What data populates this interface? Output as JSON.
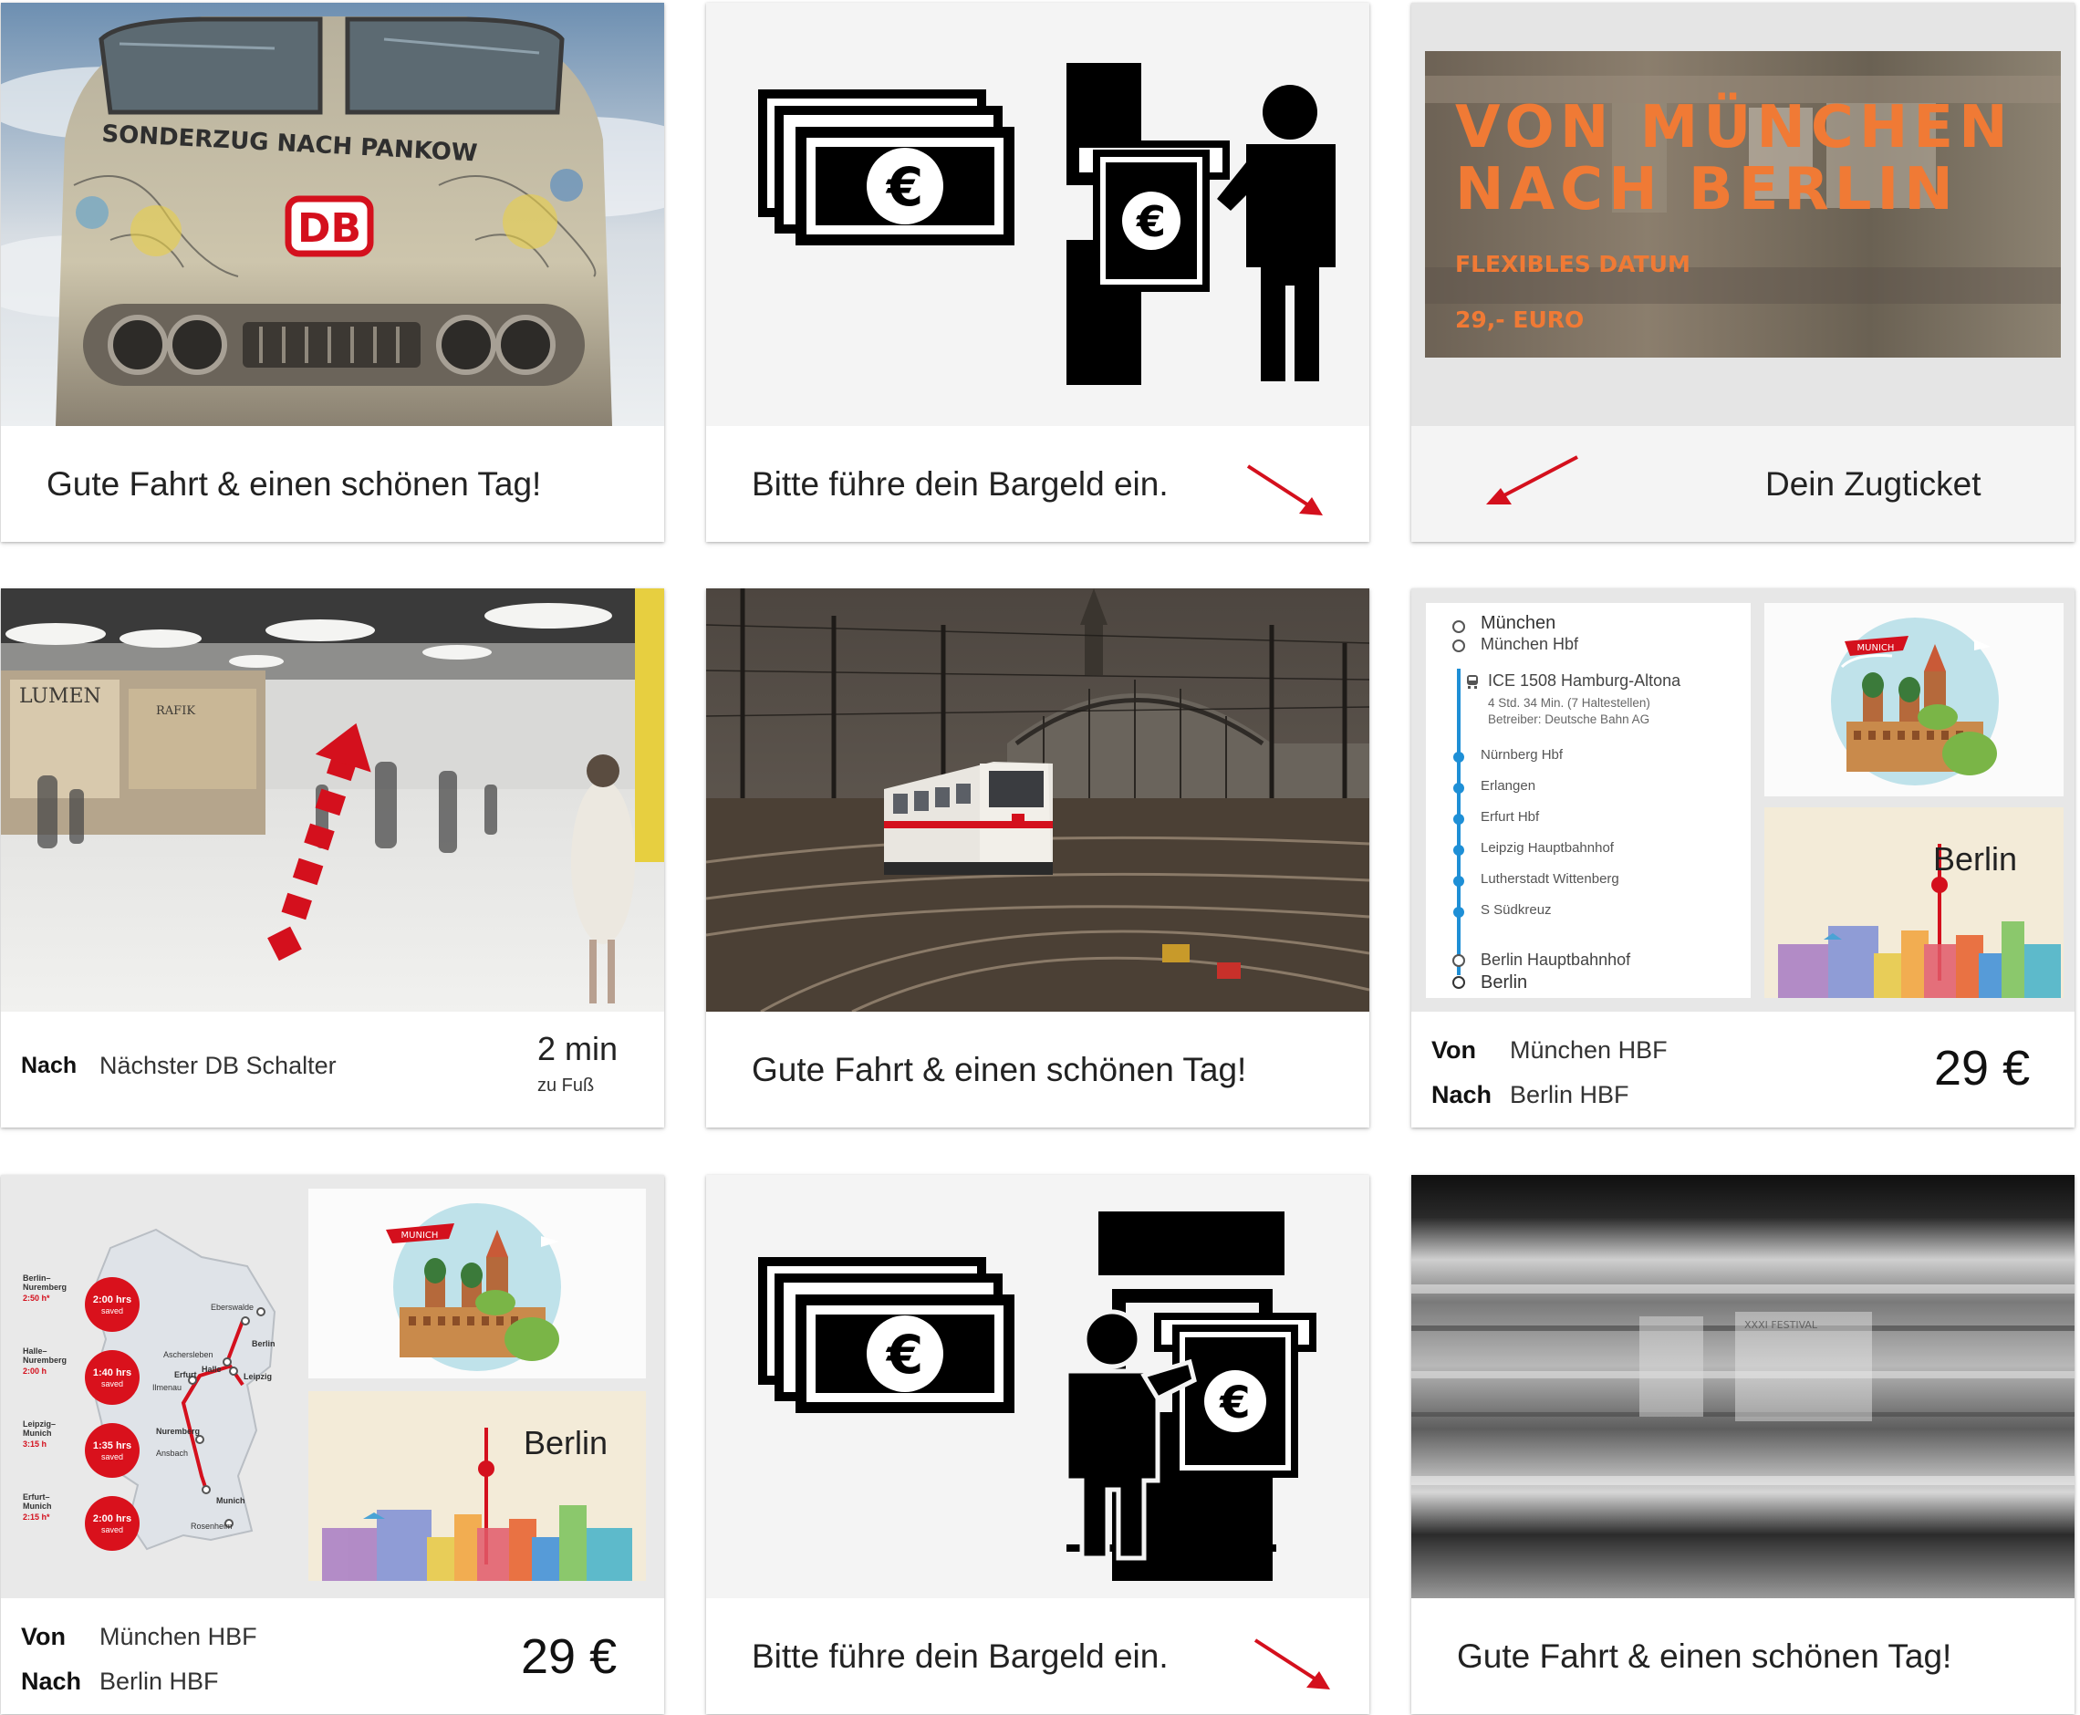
{
  "cards": {
    "farewell_1": {
      "text": "Gute Fahrt & einen schönen Tag!",
      "train_banner": "SONDERZUG NACH PANKOW",
      "logo": "DB"
    },
    "insert_cash_1": {
      "text": "Bitte führe dein Bargeld ein.",
      "currency_symbol": "€"
    },
    "ticket": {
      "text": "Dein Zugticket",
      "line1": "VON   MÜNCHEN",
      "line2": "NACH BERLIN",
      "date_label": "FLEXIBLES DATUM",
      "price_label": "29,- EURO"
    },
    "directions": {
      "to_label": "Nach",
      "destination": "Nächster DB Schalter",
      "duration": "2 min",
      "duration_sub": "zu Fuß",
      "shop_sign": "LUMEN",
      "shop_sign_2": "RAFIK"
    },
    "farewell_2": {
      "text": "Gute Fahrt & einen schönen Tag!"
    },
    "route": {
      "origin": "München",
      "origin_station": "München Hbf",
      "train": "ICE 1508 Hamburg-Altona",
      "train_details": "4 Std. 34 Min. (7 Haltestellen)",
      "operator": "Betreiber: Deutsche Bahn AG",
      "stops": [
        "Nürnberg Hbf",
        "Erlangen",
        "Erfurt Hbf",
        "Leipzig Hauptbahnhof",
        "Lutherstadt Wittenberg",
        "S Südkreuz"
      ],
      "dest_station": "Berlin Hauptbahnhof",
      "destination": "Berlin",
      "munich_banner": "MUNICH",
      "berlin_label": "Berlin",
      "from_label": "Von",
      "from_value": "München HBF",
      "to_label": "Nach",
      "to_value": "Berlin HBF",
      "price": "29 €"
    },
    "map_offer": {
      "routes": [
        {
          "name": "Berlin–\nNuremberg",
          "old_time": "2:50 h*",
          "new_time": "2:00 hrs",
          "saved": "saved"
        },
        {
          "name": "Halle–\nNuremberg",
          "old_time": "2:00 h",
          "new_time": "1:40 hrs",
          "saved": "saved"
        },
        {
          "name": "Leipzig–\nMunich",
          "old_time": "3:15 h",
          "new_time": "1:35 hrs",
          "saved": "saved"
        },
        {
          "name": "Erfurt–\nMunich",
          "old_time": "2:15 h*",
          "new_time": "2:00 hrs",
          "saved": "saved"
        }
      ],
      "cities": [
        "Eberswalde",
        "Berlin",
        "Aschersleben",
        "Halle",
        "Leipzig",
        "Erfurt",
        "Ilmenau",
        "Nuremberg",
        "Ansbach",
        "Munich",
        "Rosenheim"
      ],
      "munich_banner": "MUNICH",
      "berlin_label": "Berlin",
      "from_label": "Von",
      "from_value": "München HBF",
      "to_label": "Nach",
      "to_value": "Berlin HBF",
      "price": "29 €"
    },
    "insert_cash_2": {
      "text": "Bitte führe dein Bargeld ein.",
      "currency_symbol": "€"
    },
    "farewell_3": {
      "text": "Gute Fahrt & einen schönen Tag!",
      "poster_text": "XXXI FESTIVAL"
    }
  },
  "colors": {
    "db_red": "#d4101d",
    "ticket_orange": "#f07a35",
    "route_blue": "#1e8fd6",
    "card_bg": "#ffffff",
    "media_gray": "#f4f4f4"
  },
  "icons": [
    "arrow-down-right-icon",
    "arrow-down-left-icon",
    "money-bills-icon",
    "cash-slot-icon",
    "person-icon",
    "train-icon",
    "location-pin-icon"
  ]
}
